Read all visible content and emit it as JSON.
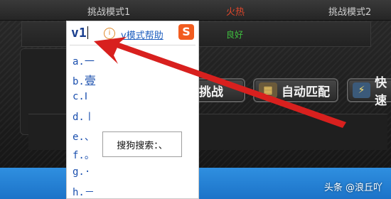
{
  "header": {
    "challenge_mode_1": "挑战模式1",
    "status_hot": "火热",
    "challenge_mode_2": "挑战模式2"
  },
  "second_row": {
    "status_good": "良好"
  },
  "game_buttons": [
    {
      "label": "尽挑战",
      "icon": "challenge-icon"
    },
    {
      "label": "自动匹配",
      "icon": "match-icon"
    },
    {
      "label": "快速",
      "icon": "lightning-icon"
    }
  ],
  "ime": {
    "composition": "v1",
    "help_link": "v模式帮助",
    "info_glyph": "i",
    "logo_glyph": "S",
    "candidates": [
      {
        "label": "a.",
        "char": "一"
      },
      {
        "label": "b.",
        "char": "壹"
      },
      {
        "label": "c.",
        "char": "Ⅰ"
      },
      {
        "label": "d.",
        "char": "〡"
      },
      {
        "label": "e.",
        "char": "、"
      },
      {
        "label": "f.",
        "char": "。"
      },
      {
        "label": "g.",
        "char": "·"
      },
      {
        "label": "h.",
        "char": "－"
      }
    ],
    "search_box": "搜狗搜索：、"
  },
  "watermark": "头条 @浪丘吖",
  "colors": {
    "arrow": "#d8201e",
    "taskbar": "#2485d8",
    "hot": "#e0472b",
    "good": "#3fbf3f"
  }
}
